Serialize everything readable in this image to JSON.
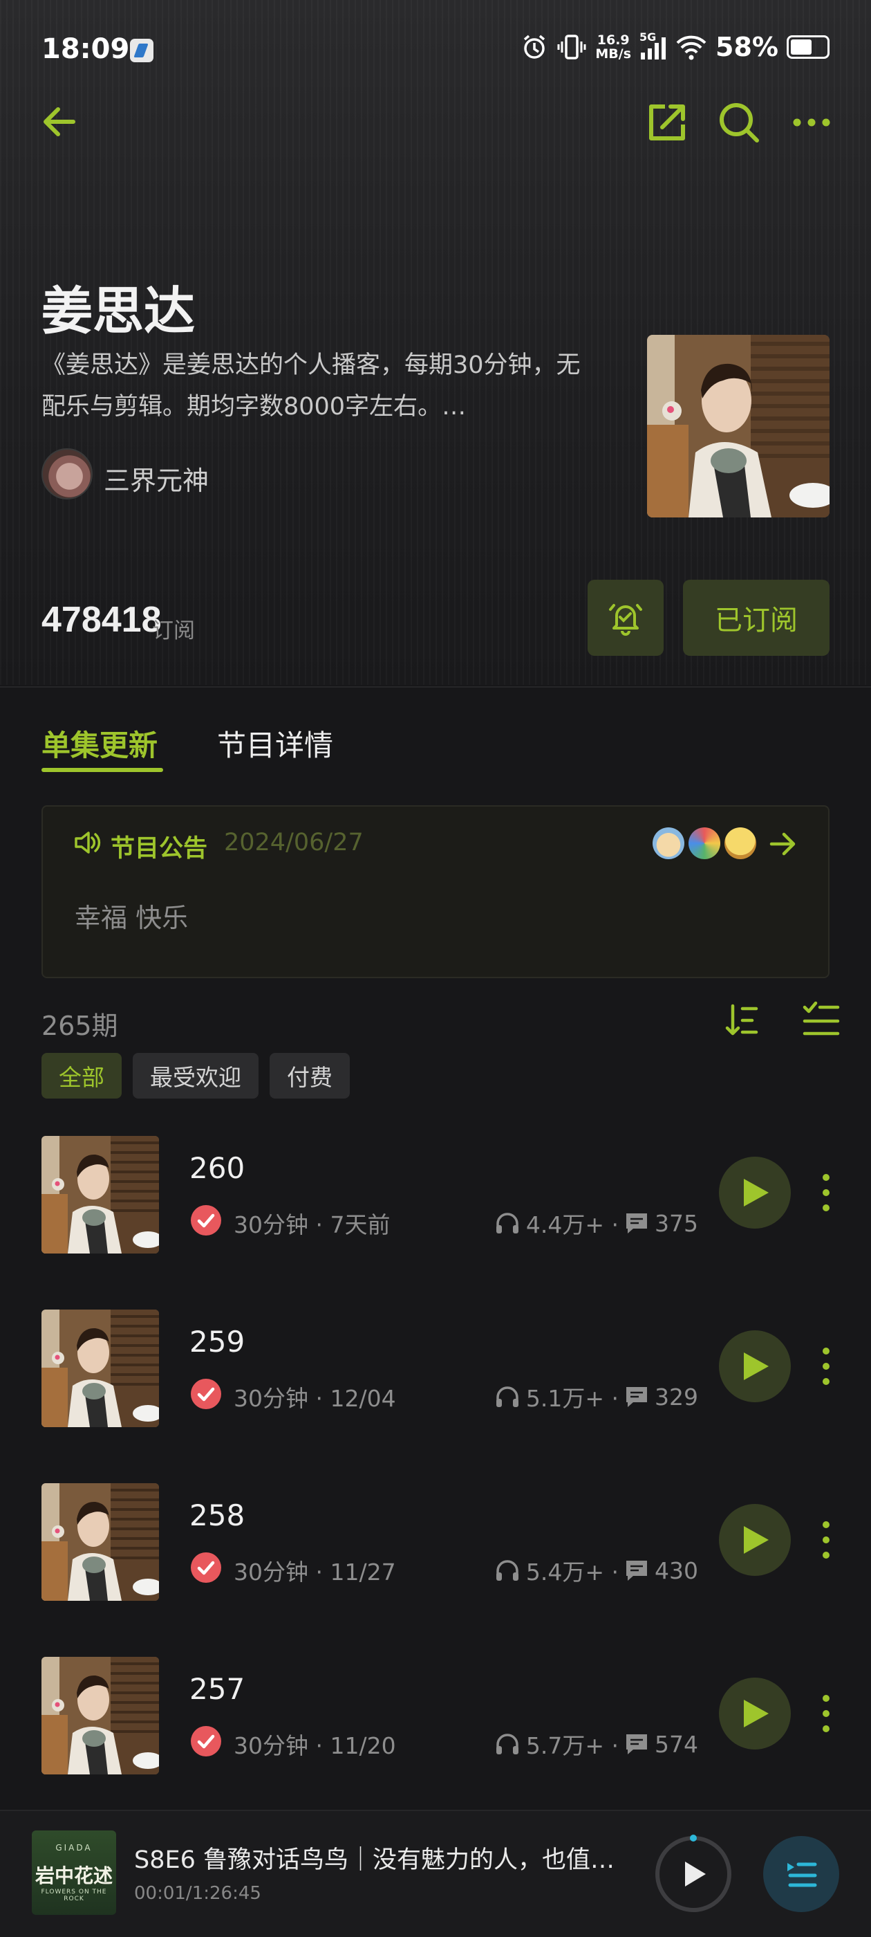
{
  "status_bar": {
    "time": "18:09",
    "net_speed_value": "16.9",
    "net_speed_unit": "MB/s",
    "signal_label": "5G",
    "battery": "58%"
  },
  "nav": {
    "back_icon": "back-arrow-icon",
    "share_icon": "share-icon",
    "search_icon": "search-icon",
    "more_icon": "more-icon"
  },
  "podcast": {
    "title": "姜思达",
    "description_line1": "《姜思达》是姜思达的个人播客，每期30分钟，无",
    "description_line2": "配乐与剪辑。期均字数8000字左右。…",
    "author": "三界元神",
    "subscribers": "478418",
    "subscribers_label": "订阅",
    "subscribed_label": "已订阅"
  },
  "tabs": [
    {
      "label": "单集更新",
      "active": true
    },
    {
      "label": "节目详情",
      "active": false
    }
  ],
  "notice": {
    "label": "节目公告",
    "date": "2024/06/27",
    "text": "幸福 快乐"
  },
  "episode_count": "265期",
  "filters": [
    {
      "label": "全部",
      "active": true
    },
    {
      "label": "最受欢迎",
      "active": false
    },
    {
      "label": "付费",
      "active": false
    }
  ],
  "episodes": [
    {
      "title": "260",
      "meta": "30分钟 · 7天前",
      "plays": "4.4万+ ·",
      "comments": "375"
    },
    {
      "title": "259",
      "meta": "30分钟 · 12/04",
      "plays": "5.1万+ ·",
      "comments": "329"
    },
    {
      "title": "258",
      "meta": "30分钟 · 11/27",
      "plays": "5.4万+ ·",
      "comments": "430"
    },
    {
      "title": "257",
      "meta": "30分钟 · 11/20",
      "plays": "5.7万+ ·",
      "comments": "574"
    }
  ],
  "player": {
    "art_small": "GIADA",
    "art_title": "岩中花述",
    "art_sub": "FLOWERS ON THE ROCK",
    "title": "S8E6 鲁豫对话鸟鸟｜没有魅力的人，也值…",
    "time": "00:01/1:26:45"
  },
  "colors": {
    "accent": "#9ec52c",
    "accent_bg": "#353d23",
    "background": "#171719",
    "check": "#e8585d"
  }
}
